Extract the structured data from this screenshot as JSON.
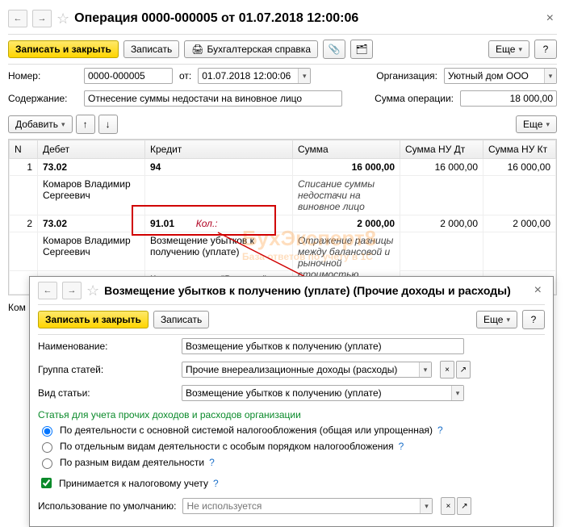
{
  "main": {
    "title": "Операция 0000-000005 от 01.07.2018 12:00:06",
    "toolbar": {
      "save_close": "Записать и закрыть",
      "save": "Записать",
      "acc_note": "Бухгалтерская справка",
      "more": "Еще",
      "help": "?"
    },
    "fields": {
      "number_label": "Номер:",
      "number_value": "0000-000005",
      "from_label": "от:",
      "date_value": "01.07.2018 12:00:06",
      "org_label": "Организация:",
      "org_value": "Уютный дом ООО",
      "content_label": "Содержание:",
      "content_value": "Отнесение суммы недостачи на виновное лицо",
      "sum_label": "Сумма операции:",
      "sum_value": "18 000,00"
    },
    "grid_toolbar": {
      "add": "Добавить",
      "more": "Еще"
    },
    "grid_headers": {
      "n": "N",
      "d": "Дебет",
      "k": "Кредит",
      "s": "Сумма",
      "sd": "Сумма НУ Дт",
      "sk": "Сумма НУ Кт"
    },
    "rows": [
      {
        "n": "1",
        "d_acc": "73.02",
        "k_acc": "94",
        "sum": "16 000,00",
        "sd": "16 000,00",
        "sk": "16 000,00",
        "d_sub": "Комаров Владимир Сергеевич",
        "s_note": "Списание суммы недостачи на виновное лицо"
      },
      {
        "n": "2",
        "d_acc": "73.02",
        "k_acc": "91.01",
        "k_quant": "Кол.:",
        "sum": "2 000,00",
        "sd": "2 000,00",
        "sk": "2 000,00",
        "d_sub": "Комаров Владимир Сергеевич",
        "k_sub1": "Возмещение убытков к получению (уплате)",
        "k_sub2": "Комплект штор \"Версаль\"",
        "s_note": "Отражение разницы между балансовой и рыночной стоимостью товара"
      }
    ],
    "truncated_label": "Ком"
  },
  "overlay": {
    "title": "Возмещение убытков к получению (уплате) (Прочие доходы и расходы)",
    "toolbar": {
      "save_close": "Записать и закрыть",
      "save": "Записать",
      "more": "Еще",
      "help": "?"
    },
    "name_label": "Наименование:",
    "name_value": "Возмещение убытков к получению (уплате)",
    "group_label": "Группа статей:",
    "group_value": "Прочие внереализационные доходы (расходы)",
    "type_label": "Вид статьи:",
    "type_value": "Возмещение убытков к получению (уплате)",
    "section": "Статья для учета прочих доходов и расходов организации",
    "r1": "По деятельности с основной системой налогообложения (общая или упрощенная)",
    "r2": "По отдельным видам деятельности с особым порядком налогообложения",
    "r3": "По разным видам деятельности",
    "chk": "Принимается к налоговому учету",
    "default_label": "Использование по умолчанию:",
    "default_placeholder": "Не используется"
  },
  "watermark": {
    "big": "БухЭксперт8",
    "small": "База ответов по учету в 1С"
  }
}
